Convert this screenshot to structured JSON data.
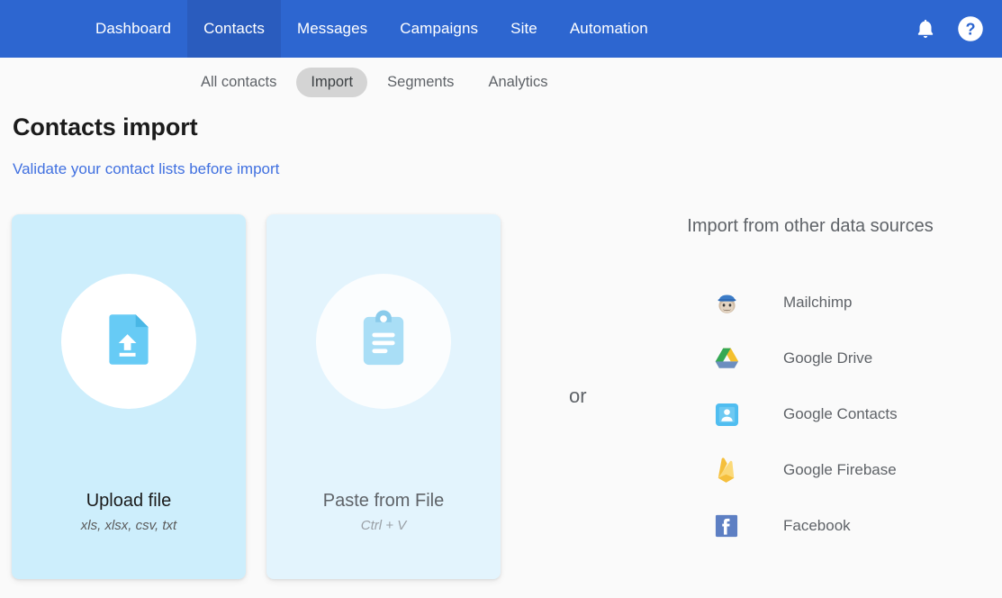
{
  "topnav": {
    "background_color": "#2D66D0",
    "active_color": "#2A5CBE",
    "items": [
      {
        "label": "Dashboard",
        "active": false
      },
      {
        "label": "Contacts",
        "active": true
      },
      {
        "label": "Messages",
        "active": false
      },
      {
        "label": "Campaigns",
        "active": false
      },
      {
        "label": "Site",
        "active": false
      },
      {
        "label": "Automation",
        "active": false
      }
    ],
    "notifications_icon": "bell-icon",
    "help_icon": "help-circle-icon"
  },
  "subnav": {
    "items": [
      {
        "label": "All contacts",
        "active": false
      },
      {
        "label": "Import",
        "active": true
      },
      {
        "label": "Segments",
        "active": false
      },
      {
        "label": "Analytics",
        "active": false
      }
    ],
    "active_pill_color": "#d4d4d4"
  },
  "page": {
    "title": "Contacts import",
    "link": "Validate your contact lists before import",
    "link_color": "#4070E0",
    "background_color": "#fafafa"
  },
  "cards": {
    "upload": {
      "title": "Upload file",
      "subtitle": "xls, xlsx, csv, txt",
      "icon": "file-upload-icon",
      "background_color": "#CDEEFC"
    },
    "paste": {
      "title": "Paste from File",
      "subtitle": "Ctrl + V",
      "icon": "clipboard-icon",
      "background_color": "#E3F4FD"
    }
  },
  "divider": {
    "text": "or"
  },
  "sources": {
    "title": "Import from other data sources",
    "items": [
      {
        "label": "Mailchimp",
        "icon": "mailchimp-icon"
      },
      {
        "label": "Google Drive",
        "icon": "google-drive-icon"
      },
      {
        "label": "Google Contacts",
        "icon": "google-contacts-icon"
      },
      {
        "label": "Google Firebase",
        "icon": "google-firebase-icon"
      },
      {
        "label": "Facebook",
        "icon": "facebook-icon"
      }
    ]
  }
}
